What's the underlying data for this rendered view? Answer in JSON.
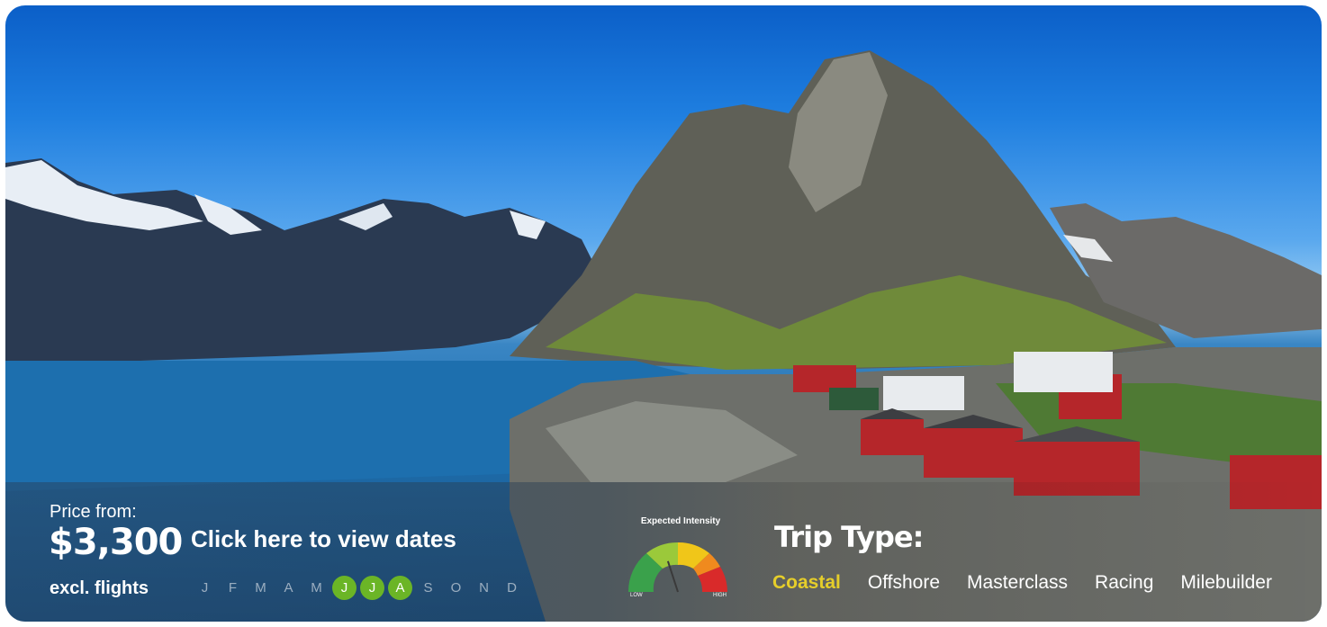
{
  "price": {
    "label": "Price from:",
    "value": "$3,300",
    "note": "excl. flights"
  },
  "dates_link": "Click here to view dates",
  "months": [
    {
      "letter": "J",
      "active": false
    },
    {
      "letter": "F",
      "active": false
    },
    {
      "letter": "M",
      "active": false
    },
    {
      "letter": "A",
      "active": false
    },
    {
      "letter": "M",
      "active": false
    },
    {
      "letter": "J",
      "active": true
    },
    {
      "letter": "J",
      "active": true
    },
    {
      "letter": "A",
      "active": true
    },
    {
      "letter": "S",
      "active": false
    },
    {
      "letter": "O",
      "active": false
    },
    {
      "letter": "N",
      "active": false
    },
    {
      "letter": "D",
      "active": false
    }
  ],
  "intensity": {
    "caption": "Expected Intensity",
    "low_label": "LOW",
    "high_label": "HIGH",
    "level": 0.4
  },
  "trip_type": {
    "title": "Trip Type:",
    "options": [
      {
        "label": "Coastal",
        "active": true
      },
      {
        "label": "Offshore",
        "active": false
      },
      {
        "label": "Masterclass",
        "active": false
      },
      {
        "label": "Racing",
        "active": false
      },
      {
        "label": "Milebuilder",
        "active": false
      }
    ]
  },
  "colors": {
    "accent_green": "#6bb526",
    "active_type": "#e6ce2a"
  }
}
